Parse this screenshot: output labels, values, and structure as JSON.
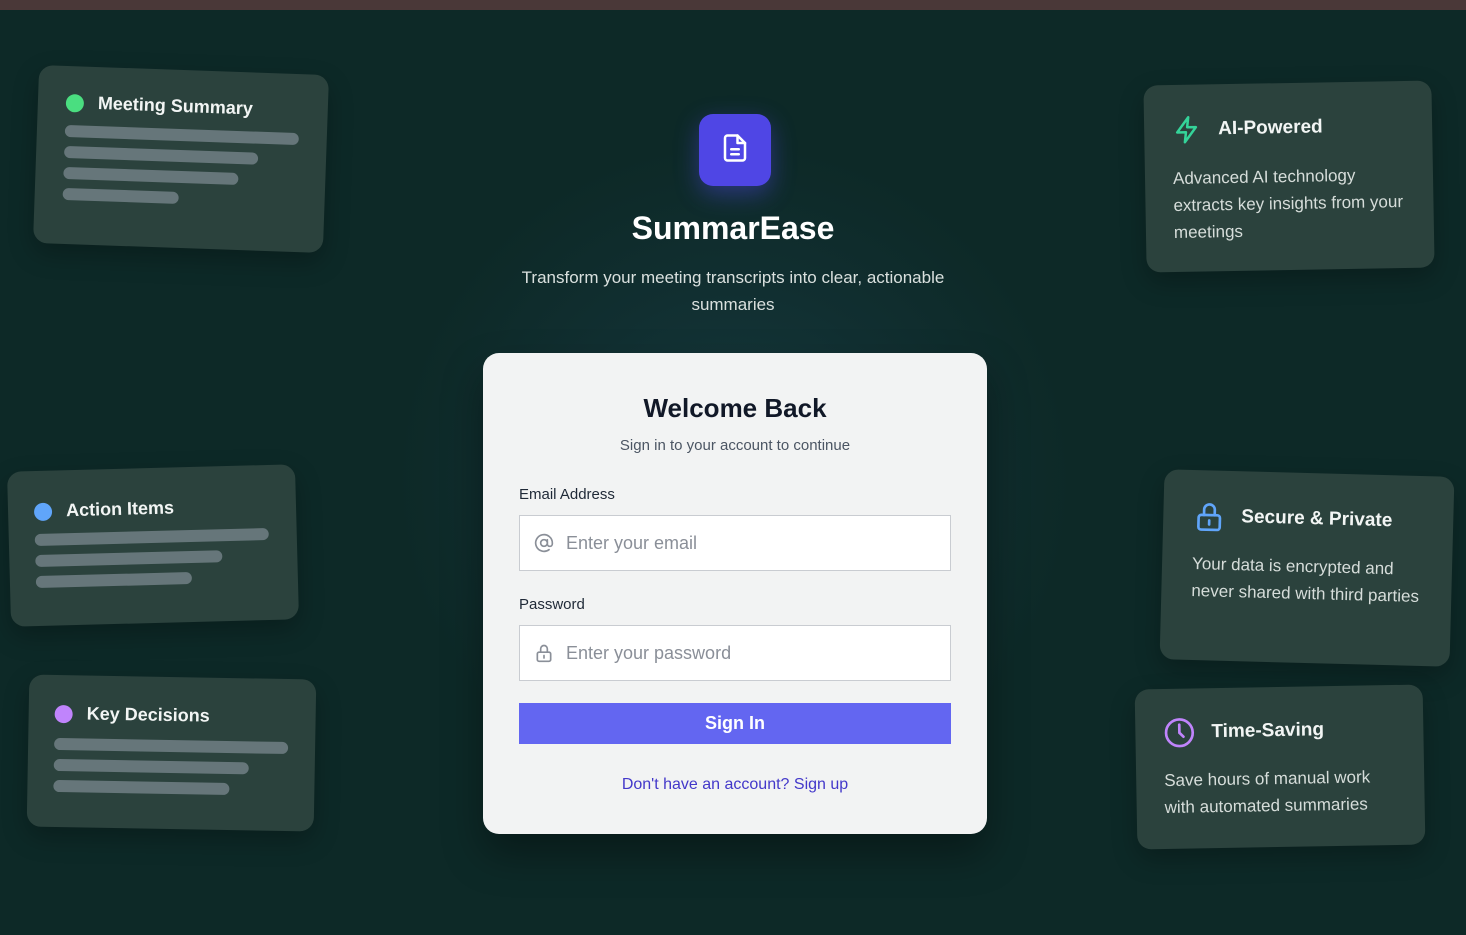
{
  "brand": {
    "name": "SummarEase",
    "tagline": "Transform your meeting transcripts into clear, actionable summaries",
    "icon": "document-icon"
  },
  "preview_cards": [
    {
      "title": "Meeting Summary",
      "dot_color": "#4ade80"
    },
    {
      "title": "Action Items",
      "dot_color": "#60a5fa"
    },
    {
      "title": "Key Decisions",
      "dot_color": "#c084fc"
    }
  ],
  "features": [
    {
      "title": "AI-Powered",
      "description": "Advanced AI technology extracts key insights from your meetings",
      "icon": "lightning-icon",
      "icon_color": "#34d399"
    },
    {
      "title": "Secure & Private",
      "description": "Your data is encrypted and never shared with third parties",
      "icon": "lock-icon",
      "icon_color": "#60a5fa"
    },
    {
      "title": "Time-Saving",
      "description": "Save hours of manual work with automated summaries",
      "icon": "clock-icon",
      "icon_color": "#c084fc"
    }
  ],
  "login": {
    "title": "Welcome Back",
    "subtitle": "Sign in to your account to continue",
    "email_label": "Email Address",
    "email_placeholder": "Enter your email",
    "password_label": "Password",
    "password_placeholder": "Enter your password",
    "submit_label": "Sign In",
    "signup_link": "Don't have an account? Sign up"
  },
  "colors": {
    "background": "#0e2a27",
    "card": "#2b423d",
    "primary": "#6366f1",
    "brand_icon": "#4f46e5",
    "link": "#4338ca"
  }
}
